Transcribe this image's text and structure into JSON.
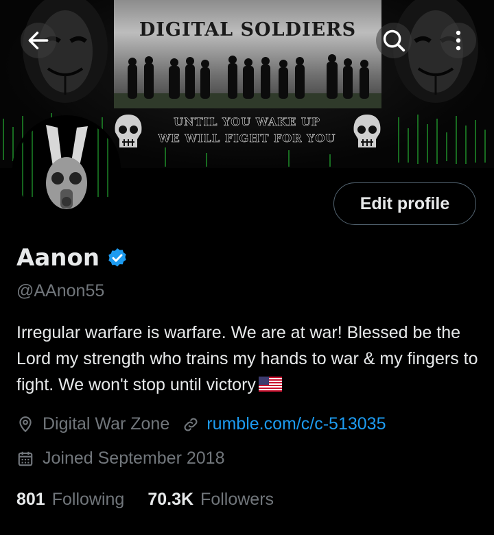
{
  "banner": {
    "title": "DIGITAL SOLDIERS",
    "motto_line1": "UNTIL YOU WAKE UP",
    "motto_line2": "WE WILL FIGHT FOR YOU"
  },
  "header": {
    "back_icon": "arrow-left-icon",
    "search_icon": "search-icon",
    "more_icon": "more-vertical-icon"
  },
  "profile": {
    "edit_label": "Edit profile",
    "name": "Aanon",
    "handle": "@AAnon55",
    "bio_text": "Irregular warfare is warfare. We are at war! Blessed be the Lord my strength who trains my hands to war & my fingers to fight. We won't stop until victory",
    "location": "Digital War Zone",
    "website": "rumble.com/c/c-513035",
    "joined": "Joined September 2018",
    "following_count": "801",
    "following_label": "Following",
    "followers_count": "70.3K",
    "followers_label": "Followers"
  },
  "colors": {
    "accent": "#1d9bf0",
    "secondary_text": "#71767b",
    "primary_text": "#e7e9ea",
    "background": "#000000"
  }
}
